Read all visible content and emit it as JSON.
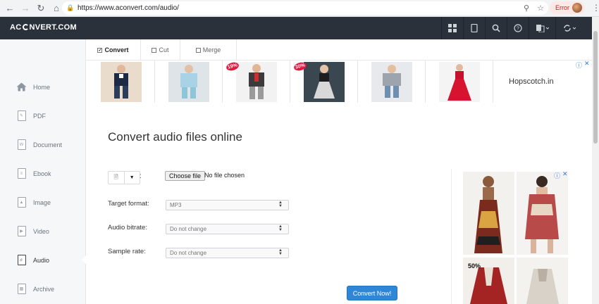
{
  "browser": {
    "url": "https://www.aconvert.com/audio/",
    "error_label": "Error"
  },
  "site": {
    "logo_prefix": "AC",
    "logo_suffix": "NVERT.COM"
  },
  "sidebar": {
    "items": [
      {
        "label": "Home",
        "icon": "home-icon"
      },
      {
        "label": "PDF",
        "icon": "pdf-icon"
      },
      {
        "label": "Document",
        "icon": "document-icon"
      },
      {
        "label": "Ebook",
        "icon": "ebook-icon"
      },
      {
        "label": "Image",
        "icon": "image-icon"
      },
      {
        "label": "Video",
        "icon": "video-icon"
      },
      {
        "label": "Audio",
        "icon": "audio-icon"
      },
      {
        "label": "Archive",
        "icon": "archive-icon"
      }
    ],
    "active": "Audio"
  },
  "tabs": [
    {
      "label": "Convert",
      "checked": true
    },
    {
      "label": "Cut",
      "checked": false
    },
    {
      "label": "Merge",
      "checked": false
    }
  ],
  "ad": {
    "brand": "Hopscotch.in",
    "badges": [
      "19%",
      "30%"
    ],
    "side_badge": "50%"
  },
  "main": {
    "title": "Convert audio files online",
    "source_colon": ":",
    "choose_file_label": "Choose file",
    "no_file_text": "No file chosen",
    "target_format_label": "Target format:",
    "target_format_value": "MP3",
    "audio_bitrate_label": "Audio bitrate:",
    "audio_bitrate_value": "Do not change",
    "sample_rate_label": "Sample rate:",
    "sample_rate_value": "Do not change",
    "convert_button": "Convert Now!"
  },
  "colors": {
    "header_bg": "#2a313b",
    "accent_blue": "#2f86d6",
    "sale_red": "#e5173f"
  }
}
